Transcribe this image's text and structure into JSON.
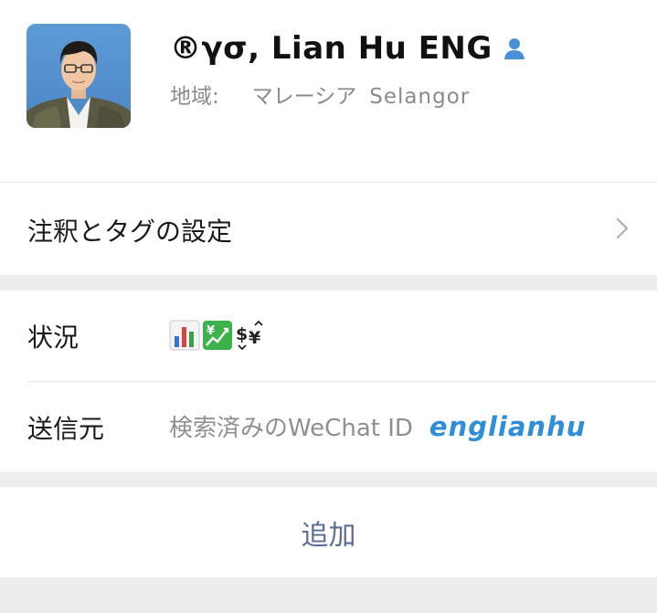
{
  "profile": {
    "display_name": "®γσ, Lian Hu ENG",
    "region_label": "地域:",
    "region_country": "マレーシア",
    "region_state": "Selangor",
    "contact_icon": "person-icon",
    "accent_color": "#4a90d9"
  },
  "tags_row": {
    "label": "注釈とタグの設定",
    "chevron_icon": "chevron-right-icon"
  },
  "status_row": {
    "label": "状況",
    "icons": [
      "bar-chart-icon",
      "yen-chart-icon",
      "currency-exchange-icon"
    ]
  },
  "source_row": {
    "label": "送信元",
    "value": "検索済みのWeChat ID",
    "wechat_id": "englianhu",
    "id_color": "#2f8ed8"
  },
  "add_button": {
    "label": "追加",
    "color": "#5a6d95"
  }
}
